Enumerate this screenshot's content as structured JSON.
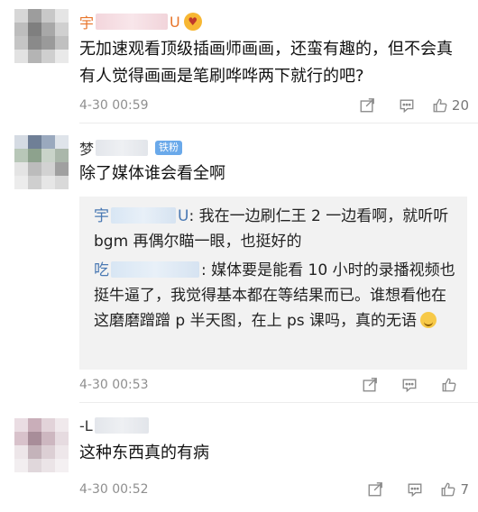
{
  "comments": [
    {
      "name_prefix": "宇",
      "name_suffix": "U",
      "badge_emoji": "😍",
      "text": "无加速观看顶级插画师画画，还蛮有趣的，但不会真有人觉得画画是笔刷哗哗两下就行的吧?",
      "time": "4-30 00:59",
      "likes": "20"
    },
    {
      "name_prefix": "梦",
      "tag": "铁粉",
      "text": "除了媒体谁会看全啊",
      "time": "4-30 00:53",
      "replies": [
        {
          "name_prefix": "宇",
          "name_suffix": "U",
          "text": ": 我在一边刷仁王 2 一边看啊，就听听 bgm 再偶尔瞄一眼，也挺好的"
        },
        {
          "name_prefix": "吃",
          "text": ": 媒体要是能看 10 小时的录播视频也挺牛逼了，我觉得基本都在等结果而已。谁想看他在这磨磨蹭蹭 p 半天图，在上 ps 课吗，真的无语"
        }
      ]
    },
    {
      "name_prefix": "-L",
      "text": "这种东西真的有病",
      "time": "4-30 00:52",
      "likes": "7"
    }
  ],
  "icons": {
    "share": "share-icon",
    "comment": "comment-icon",
    "like": "thumbs-up-icon"
  }
}
